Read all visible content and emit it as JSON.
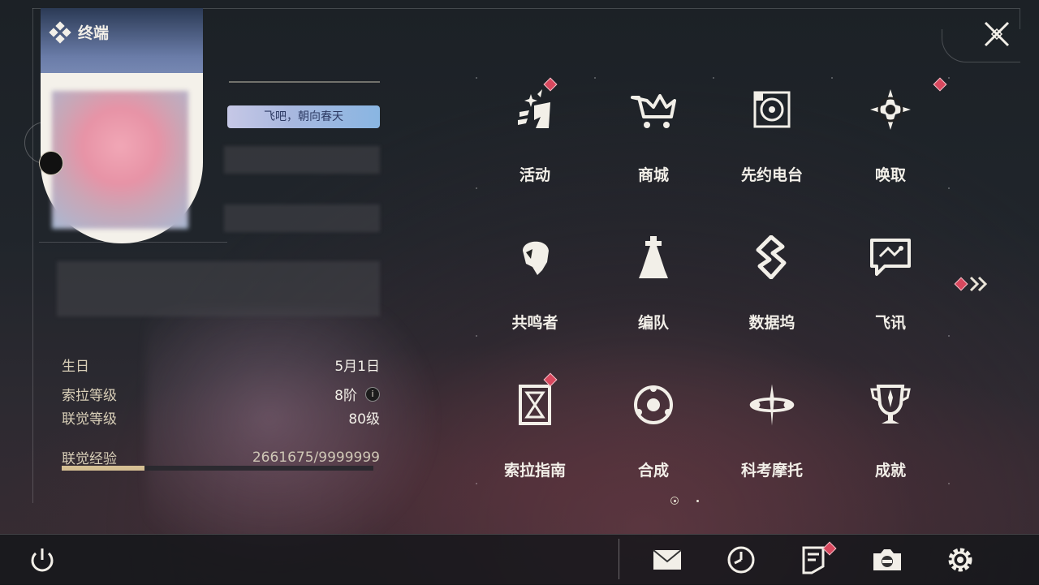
{
  "header": {
    "terminal_label": "终端"
  },
  "profile": {
    "title_badge": "飞吧，朝向春天",
    "stats": [
      {
        "label": "生日",
        "value": "5月1日"
      },
      {
        "label": "索拉等级",
        "value": "8阶"
      },
      {
        "label": "联觉等级",
        "value": "80级"
      }
    ],
    "exp": {
      "label": "联觉经验",
      "value": "2661675/9999999",
      "fraction": 0.266
    }
  },
  "menu": {
    "items": [
      {
        "label": "活动",
        "icon": "activity-icon",
        "badge": true
      },
      {
        "label": "商城",
        "icon": "shop-crown-cart-icon",
        "badge": false
      },
      {
        "label": "先约电台",
        "icon": "radio-icon",
        "badge": false
      },
      {
        "label": "唤取",
        "icon": "summon-compass-icon",
        "badge": true
      },
      {
        "label": "共鸣者",
        "icon": "resonator-head-icon",
        "badge": false
      },
      {
        "label": "编队",
        "icon": "team-chess-icon",
        "badge": false
      },
      {
        "label": "数据坞",
        "icon": "data-dock-icon",
        "badge": false
      },
      {
        "label": "飞讯",
        "icon": "message-chat-icon",
        "badge": false
      },
      {
        "label": "索拉指南",
        "icon": "guide-book-icon",
        "badge": true
      },
      {
        "label": "合成",
        "icon": "synthesis-icon",
        "badge": false
      },
      {
        "label": "科考摩托",
        "icon": "motorbike-icon",
        "badge": false
      },
      {
        "label": "成就",
        "icon": "trophy-icon",
        "badge": false
      }
    ],
    "next_page_badge": true
  },
  "bottom_bar": {
    "icons": [
      "power-icon",
      "mail-icon",
      "clock-icon",
      "notice-icon",
      "camera-icon",
      "settings-gear-icon"
    ]
  },
  "colors": {
    "accent": "#d5bf93",
    "badge": "#d8485e",
    "text": "#f2efe8"
  }
}
